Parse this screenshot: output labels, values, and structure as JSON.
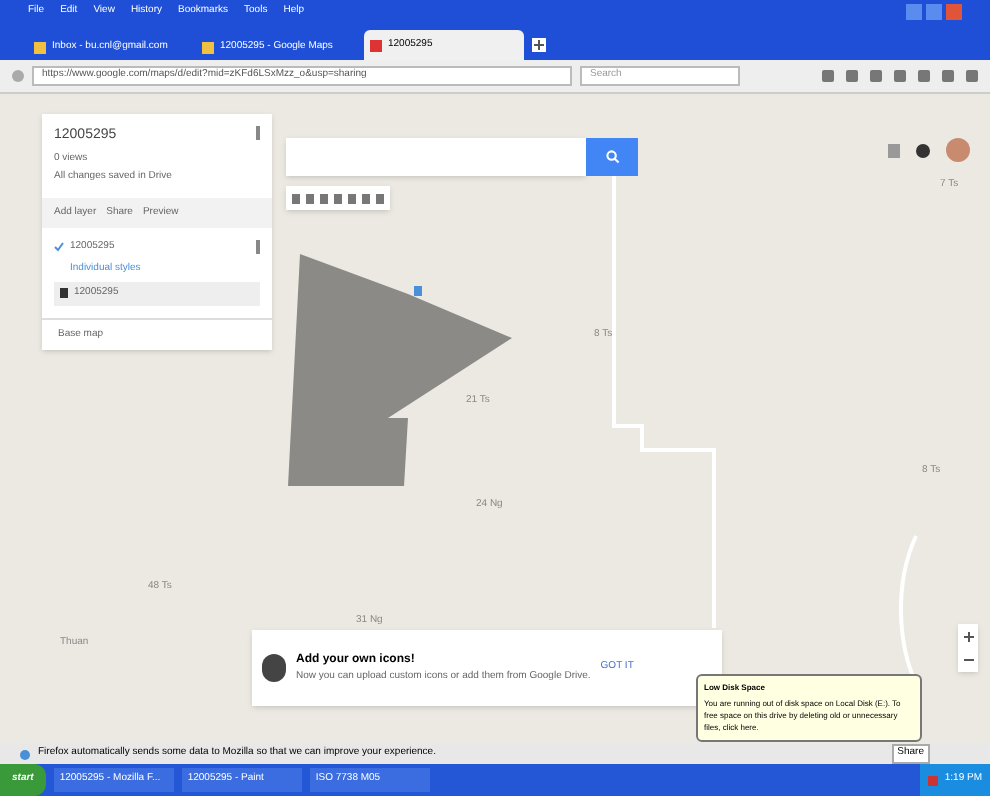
{
  "menu_bar": [
    "File",
    "Edit",
    "View",
    "History",
    "Bookmarks",
    "Tools",
    "Help"
  ],
  "tabs": [
    {
      "label": "Inbox - bu.cnl@gmail.com",
      "selected": false
    },
    {
      "label": "12005295 - Google Maps",
      "selected": false
    },
    {
      "label": "12005295",
      "selected": true
    }
  ],
  "address_bar": {
    "url": "https://www.google.com/maps/d/edit?mid=zKFd6LSxMzz_o&usp=sharing",
    "search_placeholder": "Search"
  },
  "map_panel": {
    "title": "12005295",
    "subtitle": "0 views",
    "saved": "All changes saved in Drive",
    "actions": [
      "Add layer",
      "Share",
      "Preview"
    ],
    "layer": {
      "name": "12005295",
      "checked": true,
      "style": "Individual styles",
      "feature": "12005295"
    },
    "base_map": "Base map"
  },
  "map_labels": [
    "7 Ts",
    "8 Ts",
    "21 Ts",
    "24 Ng",
    "48 Ts",
    "Thuan",
    "31 Ng",
    "8 Ts"
  ],
  "tip_card": {
    "title": "Add your own icons!",
    "body": "Now you can upload custom icons or add them from Google Drive.",
    "button": "GOT IT"
  },
  "notification_bar": "Firefox automatically sends some data to Mozilla so that we can improve your experience.",
  "notification_button": "Share",
  "balloon": {
    "title": "Low Disk Space",
    "body": "You are running out of disk space on Local Disk (E:). To free space on this drive by deleting old or unnecessary files, click here."
  },
  "taskbar": {
    "start": "start",
    "items": [
      "12005295 - Mozilla F...",
      "12005295 - Paint",
      "ISO 7738 M05"
    ],
    "clock": "1:19 PM"
  }
}
